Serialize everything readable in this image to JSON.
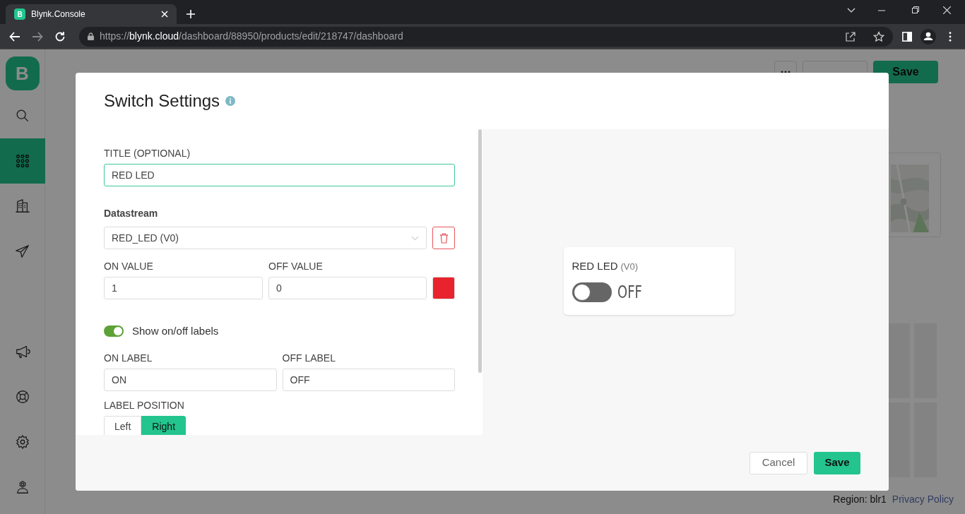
{
  "browser": {
    "tab": {
      "icon_text": "B",
      "title": "Blynk.Console"
    },
    "url": "https://**blynk.cloud**/dashboard/88950/products/edit/218747/dashboard"
  },
  "sidebar": {
    "logo_text": "B",
    "items": [
      {
        "kind": "search",
        "selected": false
      },
      {
        "kind": "grid",
        "selected": true
      },
      {
        "kind": "building",
        "selected": false
      },
      {
        "kind": "send",
        "selected": false
      },
      {
        "kind": "megaphone",
        "selected": false
      },
      {
        "kind": "lifebuoy",
        "selected": false
      },
      {
        "kind": "gear",
        "selected": false
      },
      {
        "kind": "user",
        "selected": false
      }
    ]
  },
  "page": {
    "buttons": [
      "Save"
    ],
    "footer": {
      "region": "Region: blr1",
      "link": "Privacy Policy"
    }
  },
  "dialog": {
    "title": "Switch Settings",
    "title_field": {
      "label": "TITLE (OPTIONAL)",
      "value": "RED LED",
      "focused": true
    },
    "datastream": {
      "label": "Datastream",
      "value": "RED_LED (V0)"
    },
    "on_value": {
      "label": "ON VALUE",
      "value": "1"
    },
    "off_value": {
      "label": "OFF VALUE",
      "value": "0"
    },
    "color": "#e8232d",
    "show_labels": {
      "label": "Show on/off labels",
      "on": true
    },
    "on_label": {
      "label": "ON LABEL",
      "value": "ON"
    },
    "off_label": {
      "label": "OFF LABEL",
      "value": "OFF"
    },
    "label_position": {
      "label": "LABEL POSITION",
      "options": [
        {
          "label": "Left",
          "selected": false
        },
        {
          "label": "Right",
          "selected": true
        }
      ]
    },
    "preview": {
      "title": "RED LED",
      "pin": "(V0)",
      "on": false,
      "state_text": "OFF"
    },
    "buttons": [
      "Cancel",
      "Save"
    ]
  }
}
